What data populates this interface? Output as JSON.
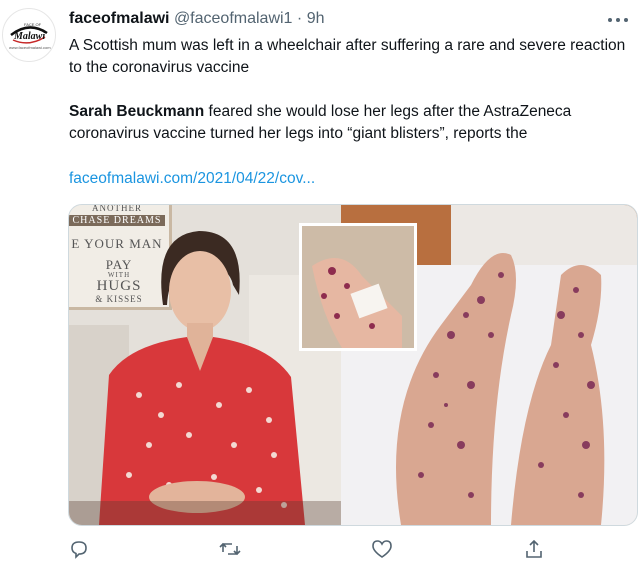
{
  "account": {
    "display_name": "faceofmalawi",
    "handle": "@faceofmalawi1",
    "separator": "·",
    "time": "9h",
    "avatar_logo_text": "Malawi",
    "avatar_logo_small": "FACE OF",
    "avatar_url_text": "www.faceofmalawi.com"
  },
  "tweet": {
    "line1": "A Scottish mum was left in a wheelchair after suffering a rare and severe reaction to the coronavirus vaccine",
    "line2_bold": "Sarah Beuckmann",
    "line2_rest": " feared she would lose her legs after the AstraZeneca coronavirus vaccine turned her legs into “giant blisters”, reports the",
    "link": "faceofmalawi.com/2021/04/22/cov..."
  },
  "media": {
    "sign_lines": [
      "ANOTHER",
      "CHASE DREAMS",
      "E YOUR MAN",
      "PAY",
      "WITH",
      "HUGS",
      "& KISSES"
    ]
  },
  "actions": {
    "reply_icon": "reply-icon",
    "retweet_icon": "retweet-icon",
    "like_icon": "like-icon",
    "share_icon": "share-icon"
  },
  "colors": {
    "link": "#1b95e0",
    "secondary_text": "#536471",
    "primary_text": "#0f1419"
  }
}
